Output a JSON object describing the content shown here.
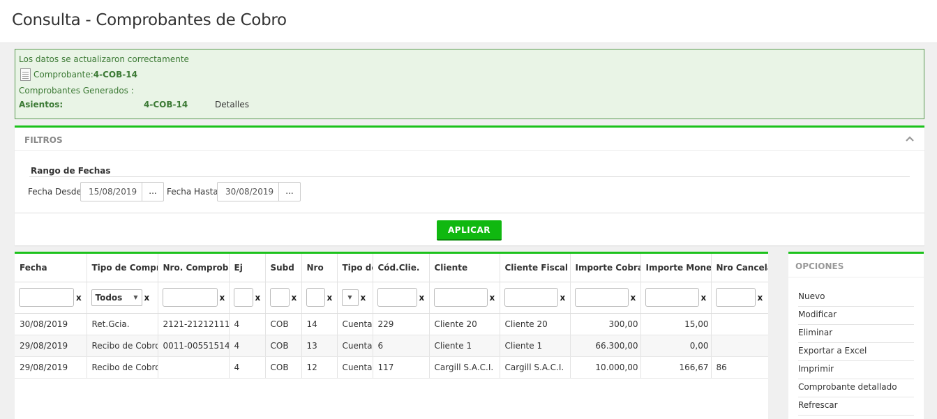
{
  "page": {
    "title": "Consulta - Comprobantes de Cobro"
  },
  "message": {
    "status": "Los datos se actualizaron correctamente",
    "comprobante_label": "Comprobante:",
    "comprobante_value": "4-COB-14",
    "generados_label": "Comprobantes Generados :",
    "asientos_label": "Asientos:",
    "asientos_value": "4-COB-14",
    "detalles": "Detalles"
  },
  "filters": {
    "title": "FILTROS",
    "rango_title": "Rango de Fechas",
    "desde_label": "Fecha Desde",
    "desde_value": "15/08/2019",
    "hasta_label": "Fecha Hasta",
    "hasta_value": "30/08/2019",
    "picker_label": "...",
    "apply_label": "APLICAR"
  },
  "grid": {
    "columns": [
      "Fecha",
      "Tipo de Compro",
      "Nro. Comprobar",
      "Ej",
      "Subd",
      "Nro",
      "Tipo de",
      "Cód.Clie.",
      "Cliente",
      "Cliente Fiscal",
      "Importe Cobrad",
      "Importe Moned",
      "Nro Cancela"
    ],
    "filter_clear": "x",
    "tipo_filter_value": "Todos",
    "rows": [
      [
        "30/08/2019",
        "Ret.Gcia.",
        "2121-21212111",
        "4",
        "COB",
        "14",
        "Cuenta",
        "229",
        "Cliente 20",
        "Cliente 20",
        "300,00",
        "15,00",
        ""
      ],
      [
        "29/08/2019",
        "Recibo de Cobro",
        "0011-00551514",
        "4",
        "COB",
        "13",
        "Cuenta",
        "6",
        "Cliente 1",
        "Cliente 1",
        "66.300,00",
        "0,00",
        ""
      ],
      [
        "29/08/2019",
        "Recibo de Cobro",
        "",
        "4",
        "COB",
        "12",
        "Cuenta",
        "117",
        "Cargill S.A.C.I.",
        "Cargill S.A.C.I.",
        "10.000,00",
        "166,67",
        "86"
      ]
    ]
  },
  "options": {
    "title": "OPCIONES",
    "items": [
      "Nuevo",
      "Modificar",
      "Eliminar",
      "Exportar a Excel",
      "Imprimir",
      "Comprobante detallado",
      "Refrescar"
    ]
  },
  "colors": {
    "accent": "#1cc21c",
    "button": "#10b810",
    "message_bg": "#e9f4e6",
    "message_text": "#3c7a35"
  }
}
